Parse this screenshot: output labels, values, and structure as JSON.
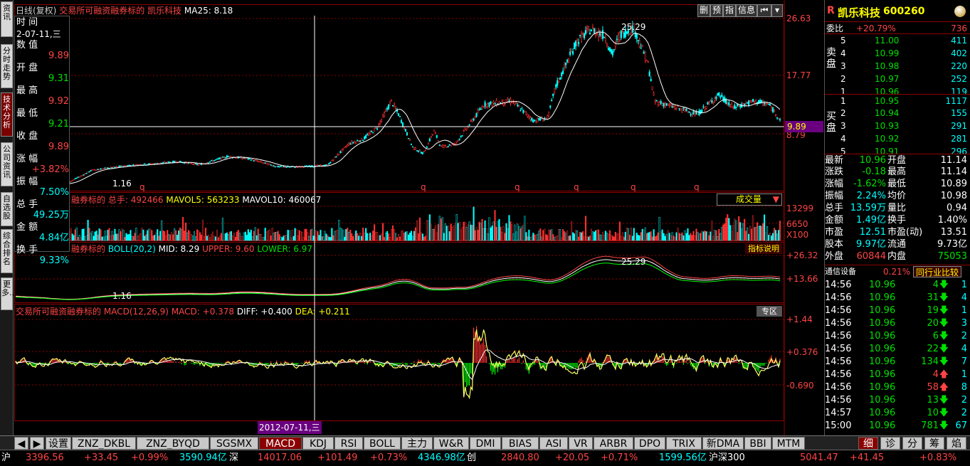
{
  "left_tabs": [
    "资讯",
    "分时走势",
    "技术分析",
    "公司资讯",
    "自选股",
    "综合排名",
    "更多.."
  ],
  "chart": {
    "header": {
      "period": "日线(复权)",
      "label": "交易所可融资融券标的",
      "name": "凯乐科技",
      "ma": "MA25: 8.18"
    },
    "toolbar": [
      "删",
      "预",
      "指",
      "信息",
      "⏮",
      "▾"
    ],
    "price_axis": [
      "26.63",
      "17.77",
      "8.79"
    ],
    "current_price_tag": "9.89",
    "peak_label": "25.29",
    "low_label": "1.16",
    "q_marker": "q",
    "vol_header": {
      "label": "融券标的",
      "total_label": "总手: 492466",
      "mavol5": "MAVOL5: 563233",
      "mavol10": "MAVOL10: 460067",
      "select": "成交量"
    },
    "vol_axis": [
      "13299",
      "6650",
      "X100"
    ],
    "boll_header": {
      "label": "融券标的",
      "boll": "BOLL(20,2)",
      "mid": "MID: 8.29",
      "upper": "UPPER: 9.60",
      "lower": "LOWER: 6.97",
      "explain": "指标说明"
    },
    "boll_axis": [
      "+26.32",
      "+13.66"
    ],
    "boll_peak": "25.29",
    "boll_low": "1.16",
    "macd_header": {
      "label": "交易所可融资融券标的",
      "macd": "MACD(12,26,9)",
      "macd_val": "MACD: +0.378",
      "diff": "DIFF: +0.400",
      "dea": "DEA: +0.211",
      "zone": "专区"
    },
    "macd_axis": [
      "+1.44",
      "+0.376",
      "-0.690"
    ],
    "date_tag": "2012-07-11,三"
  },
  "info_box": {
    "time_label": "时   间",
    "date": "2-07-11,三",
    "rows": [
      {
        "label": "数   值",
        "value": "9.89"
      },
      {
        "label": "开   盘",
        "value": "9.31"
      },
      {
        "label": "最   高",
        "value": "9.92"
      },
      {
        "label": "最   低",
        "value": "9.21"
      },
      {
        "label": "收   盘",
        "value": "9.89"
      },
      {
        "label": "涨   幅",
        "value": "+3.82%"
      },
      {
        "label": "振   幅",
        "value": "7.50%"
      },
      {
        "label": "总   手",
        "value": "49.25万"
      },
      {
        "label": "金   额",
        "value": "4.84亿"
      },
      {
        "label": "换   手",
        "value": "9.33%"
      }
    ]
  },
  "right": {
    "logo": "R",
    "title": "凯乐科技",
    "code": "600260",
    "weibi": {
      "label": "委比",
      "pct": "+20.79%",
      "val": "736"
    },
    "sell_label": "卖盘",
    "buy_label": "买盘",
    "sell": [
      {
        "n": "5",
        "p": "11.00",
        "v": "411"
      },
      {
        "n": "4",
        "p": "10.99",
        "v": "402"
      },
      {
        "n": "3",
        "p": "10.98",
        "v": "220"
      },
      {
        "n": "2",
        "p": "10.97",
        "v": "252"
      },
      {
        "n": "1",
        "p": "10.96",
        "v": "119"
      }
    ],
    "buy": [
      {
        "n": "1",
        "p": "10.95",
        "v": "1117"
      },
      {
        "n": "2",
        "p": "10.94",
        "v": "155"
      },
      {
        "n": "3",
        "p": "10.93",
        "v": "291"
      },
      {
        "n": "4",
        "p": "10.92",
        "v": "281"
      },
      {
        "n": "5",
        "p": "10.91",
        "v": "296"
      }
    ],
    "stats": [
      {
        "l1": "最新",
        "v1": "10.96",
        "l2": "开盘",
        "v2": "11.14"
      },
      {
        "l1": "涨跌",
        "v1": "-0.18",
        "l2": "最高",
        "v2": "11.14"
      },
      {
        "l1": "涨幅",
        "v1": "-1.62%",
        "l2": "最低",
        "v2": "10.89"
      },
      {
        "l1": "振幅",
        "v1": "2.24%",
        "l2": "均价",
        "v2": "10.98"
      },
      {
        "l1": "总手",
        "v1": "13.59万",
        "l2": "量比",
        "v2": "0.94"
      },
      {
        "l1": "金额",
        "v1": "1.49亿",
        "l2": "换手",
        "v2": "1.40%"
      },
      {
        "l1": "市盈",
        "v1": "12.51",
        "l2": "市盈(动)",
        "v2": "13.51"
      },
      {
        "l1": "股本",
        "v1": "9.97亿",
        "l2": "流通",
        "v2": "9.73亿"
      },
      {
        "l1": "外盘",
        "v1": "60844",
        "l2": "内盘",
        "v2": "75053"
      }
    ],
    "industry": {
      "name": "通信设备",
      "pct": "0.21%",
      "btn": "同行业比较"
    },
    "ticks": [
      {
        "t": "14:56",
        "p": "10.96",
        "v": "4",
        "d": "down",
        "n": "1"
      },
      {
        "t": "14:56",
        "p": "10.96",
        "v": "31",
        "d": "down",
        "n": "4"
      },
      {
        "t": "14:56",
        "p": "10.96",
        "v": "19",
        "d": "down",
        "n": "1"
      },
      {
        "t": "14:56",
        "p": "10.96",
        "v": "20",
        "d": "down",
        "n": "3"
      },
      {
        "t": "14:56",
        "p": "10.96",
        "v": "6",
        "d": "down",
        "n": "2"
      },
      {
        "t": "14:56",
        "p": "10.96",
        "v": "22",
        "d": "down",
        "n": "4"
      },
      {
        "t": "14:56",
        "p": "10.96",
        "v": "134",
        "d": "down",
        "n": "7"
      },
      {
        "t": "14:56",
        "p": "10.96",
        "v": "4",
        "d": "up",
        "n": "1"
      },
      {
        "t": "14:56",
        "p": "10.96",
        "v": "58",
        "d": "up",
        "n": "8"
      },
      {
        "t": "14:56",
        "p": "10.96",
        "v": "13",
        "d": "down",
        "n": "2"
      },
      {
        "t": "14:57",
        "p": "10.96",
        "v": "10",
        "d": "down",
        "n": "2"
      },
      {
        "t": "15:00",
        "p": "10.96",
        "v": "781",
        "d": "down",
        "n": "67"
      }
    ]
  },
  "bottom_tabs": [
    "设置",
    "ZNZ_DKBL",
    "ZNZ_BYQD",
    "SGSMX",
    "MACD",
    "KDJ",
    "RSI",
    "BOLL",
    "主力",
    "W&R",
    "DMI",
    "BIAS",
    "ASI",
    "VR",
    "ARBR",
    "DPO",
    "TRIX",
    "新DMA",
    "BBI",
    "MTM"
  ],
  "right_tabs": [
    "细",
    "诊",
    "分",
    "筹",
    "焰"
  ],
  "status": {
    "sh_label": "沪",
    "sh_val": "3396.56",
    "sh_chg": "+33.45",
    "sh_pct": "+0.99%",
    "sh_amt": "3590.94亿",
    "sz_label": "深",
    "sz_val": "14017.06",
    "sz_chg": "+101.49",
    "sz_pct": "+0.73%",
    "sz_amt": "4346.98亿",
    "cy_label": "创",
    "cy_val": "2840.80",
    "cy_chg": "+20.05",
    "cy_pct": "+0.71%",
    "cy_amt": "1599.56亿",
    "hs_label": "沪深300",
    "hs_val": "5041.47",
    "hs_chg": "+41.45",
    "hs_pct": "+0.83%"
  }
}
